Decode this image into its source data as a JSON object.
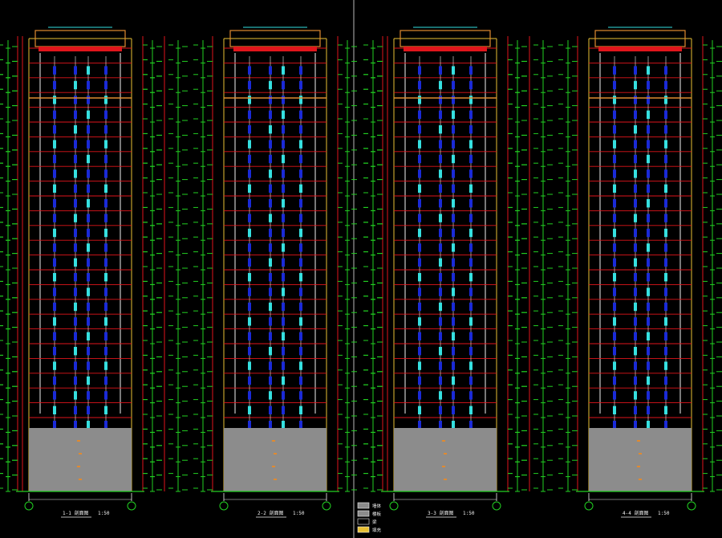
{
  "drawing": {
    "background": "#000000",
    "colors": {
      "red": "#e0151b",
      "green": "#22d022",
      "white": "#f2f2f2",
      "yellow": "#e8c033",
      "cyan": "#35e0e0",
      "blue": "#1a2ad8",
      "grey": "#8c8c8c",
      "orange": "#e08a30",
      "divider": "#9a9a9a"
    },
    "sheets": [
      {
        "side": "left",
        "elevations": [
          {
            "title": "1-1 剖面图",
            "scale": "1:50"
          },
          {
            "title": "2-2 剖面图",
            "scale": "1:50"
          }
        ]
      },
      {
        "side": "right",
        "elevations": [
          {
            "title": "3-3 剖面图",
            "scale": "1:50"
          },
          {
            "title": "4-4 剖面图",
            "scale": "1:50"
          }
        ]
      }
    ],
    "legend": [
      "墙体",
      "楼板",
      "梁",
      "填充"
    ]
  }
}
